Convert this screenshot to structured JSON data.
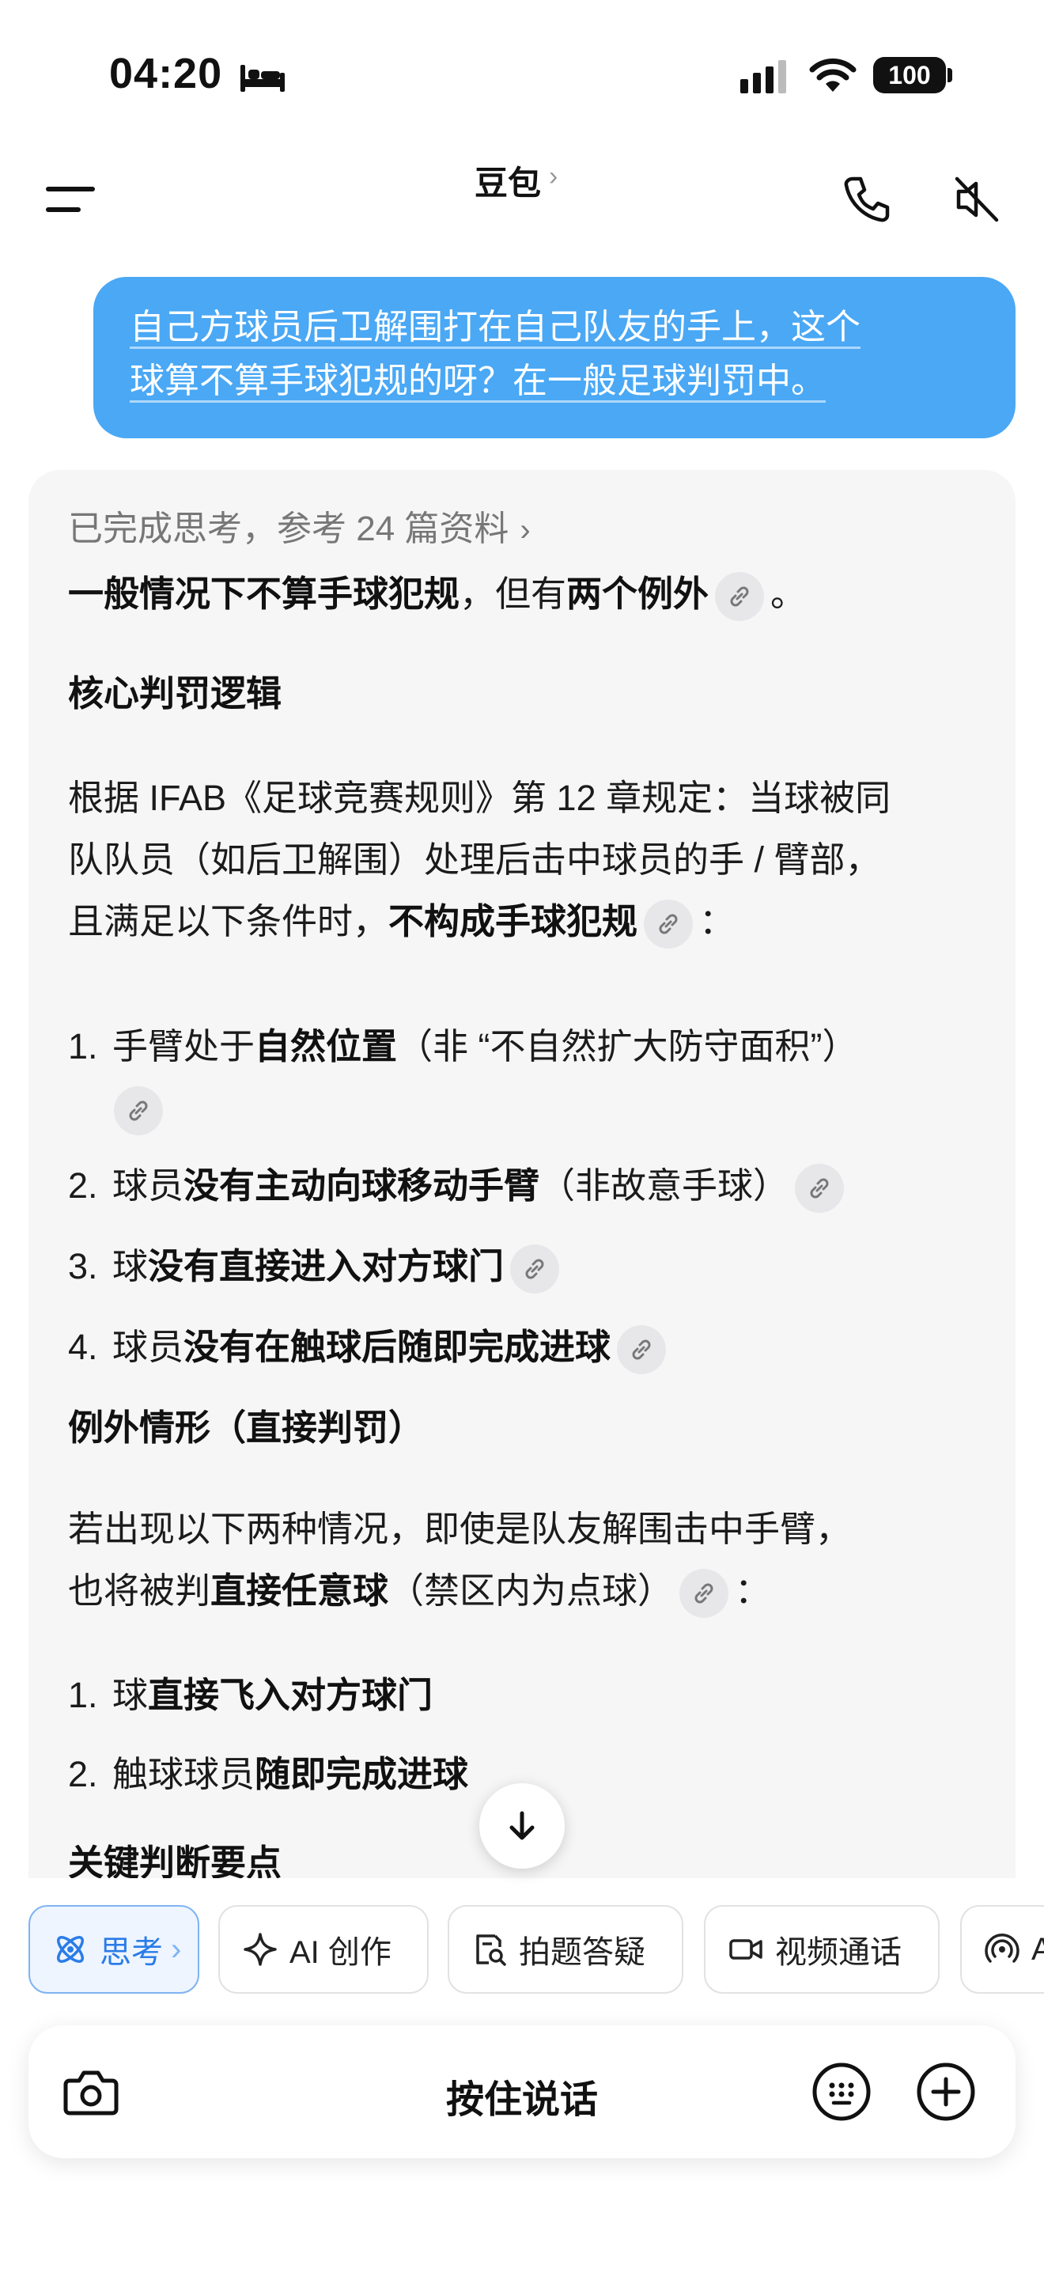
{
  "status_bar": {
    "time": "04:20",
    "battery": "100"
  },
  "header": {
    "title": "豆包",
    "chevron": "›"
  },
  "user_message": {
    "line1": "自己方球员后卫解围打在自己队友的手上，这个",
    "line2": "球算不算手球犯规的呀？在一般足球判罚中。"
  },
  "answer": {
    "thinking": "已完成思考，参考 24 篇资料",
    "summary_a": "一般情况下不算手球犯规",
    "summary_b": "，但有",
    "summary_c": "两个例外",
    "summary_d": "。",
    "h_core": "核心判罚逻辑",
    "p1_line1": "根据 IFAB《足球竞赛规则》第 12 章规定：当球被同",
    "p1_line2": "队队员（如后卫解围）处理后击中球员的手 / 臂部，",
    "p1_line3a": "且满足以下条件时，",
    "p1_line3b": "不构成手球犯规",
    "p1_line3c": "：",
    "list1": [
      {
        "num": "1.",
        "pre": "手臂处于",
        "bold": "自然位置",
        "post": "（非 “不自然扩大防守面积”）"
      },
      {
        "num": "2.",
        "pre": "球员",
        "bold": "没有主动向球移动手臂",
        "post": "（非故意手球）"
      },
      {
        "num": "3.",
        "pre": "球",
        "bold": "没有直接进入对方球门",
        "post": ""
      },
      {
        "num": "4.",
        "pre": "球员",
        "bold": "没有在触球后随即完成进球",
        "post": ""
      }
    ],
    "h_exception": "例外情形（直接判罚）",
    "p2_line1": "若出现以下两种情况，即使是队友解围击中手臂，",
    "p2_line2a": "也将被判",
    "p2_line2b": "直接任意球",
    "p2_line2c": "（禁区内为点球）",
    "p2_line2d": "：",
    "list2": [
      {
        "num": "1.",
        "pre": "球",
        "bold": "直接飞入对方球门"
      },
      {
        "num": "2.",
        "pre": "触球球员",
        "bold": "随即完成进球"
      }
    ],
    "h_key": "关键判断要点"
  },
  "chips": {
    "think": "思考",
    "think_chevron": "›",
    "ai_create": "AI 创作",
    "photo_qa": "拍题答疑",
    "video_call": "视频通话",
    "partial": "A"
  },
  "input": {
    "hold_to_talk": "按住说话"
  },
  "colors": {
    "accent": "#4aa8f5",
    "chip_active": "#2a7ce8"
  }
}
